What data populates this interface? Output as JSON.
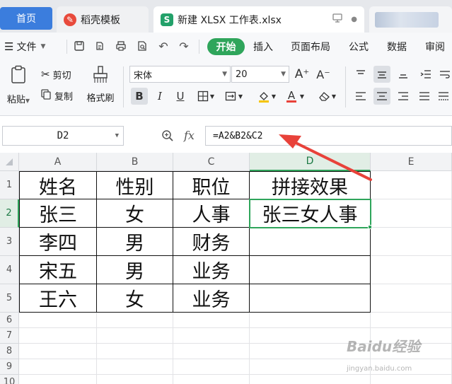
{
  "tabs": {
    "home": "首页",
    "docer": "稻壳模板",
    "file": "新建 XLSX 工作表.xlsx"
  },
  "menu": {
    "file_label": "文件",
    "start": "开始",
    "insert": "插入",
    "page_layout": "页面布局",
    "formulas": "公式",
    "data": "数据",
    "review": "审阅"
  },
  "ribbon": {
    "paste": "粘贴",
    "cut": "剪切",
    "copy": "复制",
    "format_painter": "格式刷",
    "font_name": "宋体",
    "font_size": "20",
    "bold": "B",
    "italic": "I",
    "underline": "U",
    "increase_font": "A⁺",
    "decrease_font": "A⁻",
    "fx": "fx"
  },
  "formula_bar": {
    "cell_ref": "D2",
    "formula": "=A2&B2&C2"
  },
  "sheet": {
    "columns": [
      "A",
      "B",
      "C",
      "D",
      "E"
    ],
    "rows": [
      "1",
      "2",
      "3",
      "4",
      "5",
      "6",
      "7",
      "8",
      "9",
      "10"
    ],
    "cells": [
      [
        "姓名",
        "性别",
        "职位",
        "拼接效果"
      ],
      [
        "张三",
        "女",
        "人事",
        "张三女人事"
      ],
      [
        "李四",
        "男",
        "财务",
        ""
      ],
      [
        "宋五",
        "男",
        "业务",
        ""
      ],
      [
        "王六",
        "女",
        "业务",
        ""
      ]
    ],
    "active_cell": "D2",
    "accent_color": "#2fa55b",
    "annotation_color": "#e8423a"
  },
  "watermark": {
    "brand": "Baidu经验",
    "url": "jingyan.baidu.com"
  }
}
